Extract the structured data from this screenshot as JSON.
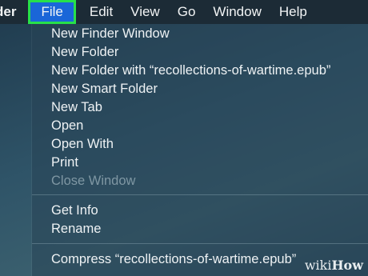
{
  "menubar": {
    "app": "der",
    "items": [
      "File",
      "Edit",
      "View",
      "Go",
      "Window",
      "Help"
    ]
  },
  "file_menu": {
    "items": [
      {
        "label": "New Finder Window"
      },
      {
        "label": "New Folder"
      },
      {
        "label": "New Folder with “recollections-of-wartime.epub”"
      },
      {
        "label": "New Smart Folder"
      },
      {
        "label": "New Tab"
      },
      {
        "label": "Open"
      },
      {
        "label": "Open With"
      },
      {
        "label": "Print"
      },
      {
        "label": "Close Window"
      },
      {
        "label": "Get Info"
      },
      {
        "label": "Rename"
      },
      {
        "label": "Compress “recollections-of-wartime.epub”"
      }
    ]
  },
  "watermark": {
    "pre": "wiki",
    "post": "How"
  },
  "colors": {
    "highlight": "#1a66d8",
    "annotation_box": "#27e04a",
    "menubar_bg": "#1c2b36"
  }
}
